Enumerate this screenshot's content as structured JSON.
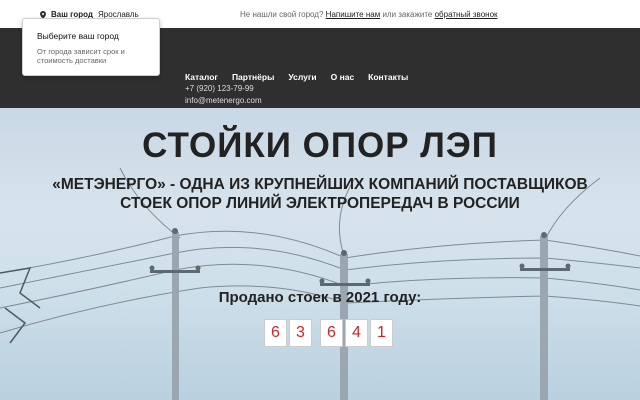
{
  "topbar": {
    "city_label": "Ваш город",
    "city_value": "Ярославль",
    "help_prefix": "Не нашли свой город?",
    "help_link1": "Напишите нам",
    "help_middle": "или закажите",
    "help_link2": "обратный звонок"
  },
  "popup": {
    "title": "Выберите ваш город",
    "description": "От города зависит срок и стоимость доставки"
  },
  "nav": {
    "items": [
      "Каталог",
      "Партнёры",
      "Услуги",
      "О нас",
      "Контакты"
    ]
  },
  "contacts": {
    "phone": "+7 (920) 123-79-99",
    "email": "info@metenergo.com"
  },
  "hero": {
    "title": "СТОЙКИ ОПОР ЛЭП",
    "subtitle": "«МЕТЭНЕРГО» - ОДНА ИЗ КРУПНЕЙШИХ КОМПАНИЙ ПОСТАВЩИКОВ СТОЕК ОПОР ЛИНИЙ ЭЛЕКТРОПЕРЕДАЧ В РОССИИ",
    "sold_label": "Продано стоек в 2021 году:",
    "counter": [
      "6",
      "3",
      "6",
      "4",
      "1"
    ]
  },
  "colors": {
    "header_bg": "#2f2f2f",
    "counter_digit": "#c62828",
    "title": "#222222"
  },
  "icons": {
    "city": "map-pin-icon"
  }
}
